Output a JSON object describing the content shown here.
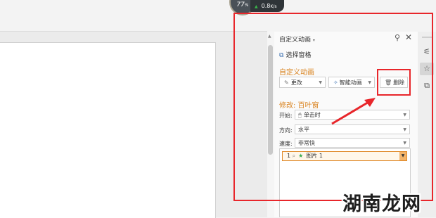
{
  "speed_widget": {
    "percent": "77",
    "percent_unit": "%",
    "net_speed": "0.8",
    "net_unit": "K/s"
  },
  "panel": {
    "title": "自定义动画",
    "selection_pane": "选择窗格",
    "section_custom": "自定义动画",
    "change_button": "更改",
    "smart_button": "智能动画",
    "delete_button": "删除",
    "section_modify": "修改: 百叶窗",
    "start_label": "开始:",
    "start_value": "单击时",
    "direction_label": "方向:",
    "direction_value": "水平",
    "speed_label": "速度:",
    "speed_value": "非常快",
    "anim_item": {
      "index": "1",
      "name": "图片 1"
    }
  },
  "watermark": "湖南龙网",
  "colors": {
    "annotation_red": "#e8262b",
    "section_orange": "#d9831f",
    "star_green": "#39a84c"
  }
}
